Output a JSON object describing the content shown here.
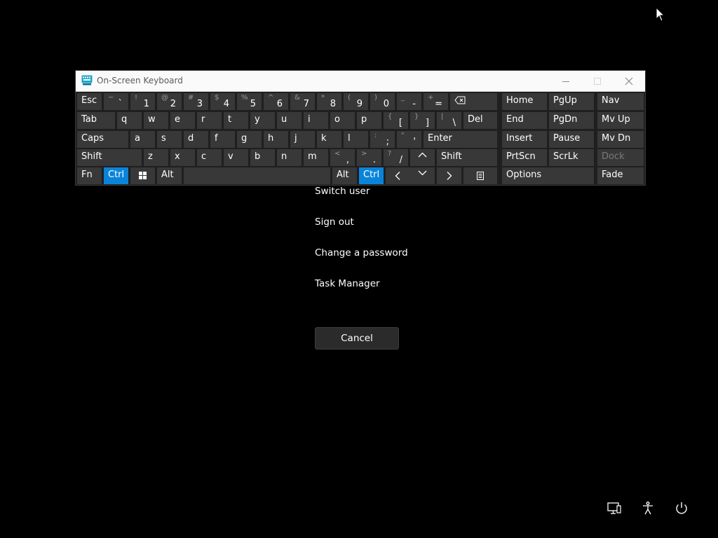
{
  "window": {
    "title": "On-Screen Keyboard",
    "icon": "keyboard-app-icon"
  },
  "keys": {
    "esc": "Esc",
    "tilde": {
      "shift": "~",
      "main": "`"
    },
    "k1": {
      "shift": "!",
      "main": "1"
    },
    "k2": {
      "shift": "@",
      "main": "2"
    },
    "k3": {
      "shift": "#",
      "main": "3"
    },
    "k4": {
      "shift": "$",
      "main": "4"
    },
    "k5": {
      "shift": "%",
      "main": "5"
    },
    "k6": {
      "shift": "^",
      "main": "6"
    },
    "k7": {
      "shift": "&",
      "main": "7"
    },
    "k8": {
      "shift": "*",
      "main": "8"
    },
    "k9": {
      "shift": "(",
      "main": "9"
    },
    "k0": {
      "shift": ")",
      "main": "0"
    },
    "minus": {
      "shift": "_",
      "main": "-"
    },
    "equals": {
      "shift": "+",
      "main": "="
    },
    "backspace_icon": "backspace-icon",
    "tab": "Tab",
    "q": "q",
    "w": "w",
    "e": "e",
    "r": "r",
    "t": "t",
    "y": "y",
    "u": "u",
    "i": "i",
    "o": "o",
    "p": "p",
    "lbracket": {
      "shift": "{",
      "main": "["
    },
    "rbracket": {
      "shift": "}",
      "main": "]"
    },
    "backslash": {
      "shift": "|",
      "main": "\\"
    },
    "del": "Del",
    "caps": "Caps",
    "a": "a",
    "s": "s",
    "d": "d",
    "f": "f",
    "g": "g",
    "h": "h",
    "j": "j",
    "k": "k",
    "l": "l",
    "semicolon": {
      "shift": ":",
      "main": ";"
    },
    "quote": {
      "shift": "\"",
      "main": "'"
    },
    "enter": "Enter",
    "shift": "Shift",
    "z": "z",
    "x": "x",
    "c": "c",
    "v": "v",
    "b": "b",
    "n": "n",
    "m": "m",
    "comma": {
      "shift": "<",
      "main": ","
    },
    "period": {
      "shift": ">",
      "main": "."
    },
    "slash": {
      "shift": "?",
      "main": "/"
    },
    "fn": "Fn",
    "ctrl": "Ctrl",
    "win_icon": "windows-logo-icon",
    "alt": "Alt",
    "menu_icon": "context-menu-icon",
    "home": "Home",
    "pgup": "PgUp",
    "nav": "Nav",
    "end": "End",
    "pgdn": "PgDn",
    "mvup": "Mv Up",
    "insert": "Insert",
    "pause": "Pause",
    "mvdn": "Mv Dn",
    "prtscn": "PrtScn",
    "scrlk": "ScrLk",
    "dock": "Dock",
    "options": "Options",
    "fade": "Fade"
  },
  "menu": {
    "switch_user": "Switch user",
    "sign_out": "Sign out",
    "change_password": "Change a password",
    "task_manager": "Task Manager",
    "cancel": "Cancel"
  },
  "system_icons": [
    "network-icon",
    "accessibility-icon",
    "power-icon"
  ],
  "colors": {
    "background": "#000000",
    "key": "#383838",
    "key_active": "#0a84d8",
    "titlebar": "#fafafa"
  }
}
